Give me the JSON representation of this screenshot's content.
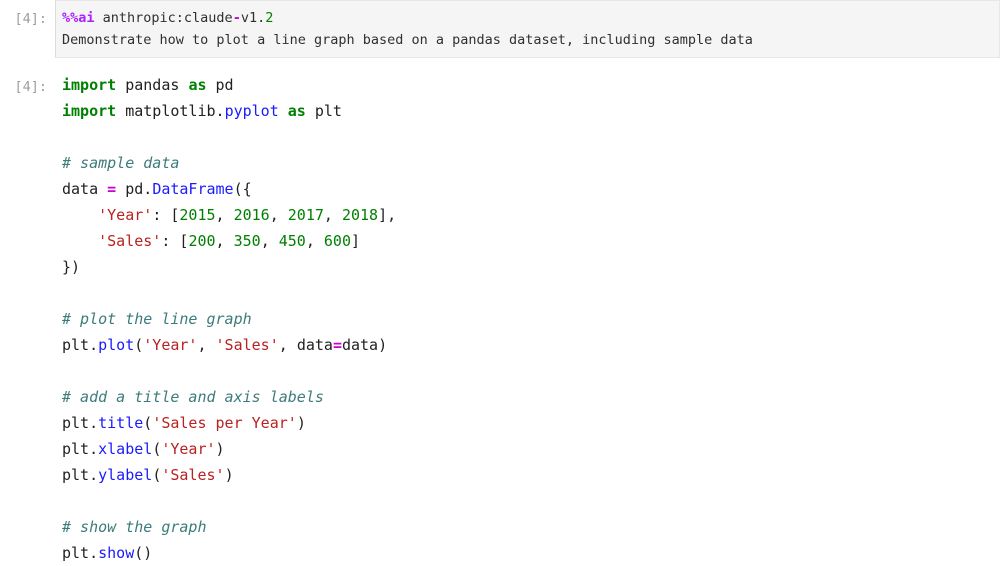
{
  "notebook": {
    "app": "jupyter-notebook",
    "background": "#ffffff",
    "colors": {
      "keyword": "#008000",
      "string": "#ba2121",
      "number": "#008000",
      "function": "#1a1aff",
      "operator": "#cc00cc",
      "comment": "#3d7b7b",
      "magic": "#aa22ff",
      "prompt": "#9e9e9e",
      "cell_background": "#f5f5f5",
      "cell_border": "#e7e7e7"
    },
    "cells": [
      {
        "id": "cell-magic",
        "type": "magic",
        "prompt_label": "[4]:",
        "execution_count": 4,
        "lines": {
          "l0_magic": "%%ai",
          "l0_provider": " anthropic:claude",
          "l0_dash": "-",
          "l0_version": "v1.",
          "l0_minor": "2",
          "l1_prompt": "Demonstrate how to plot a line graph based on a pandas dataset, including sample data"
        }
      },
      {
        "id": "cell-code",
        "type": "code",
        "prompt_label": "[4]:",
        "execution_count": 4,
        "lines": {
          "import_kw": "import",
          "pandas_mod": " pandas ",
          "as_kw1": "as",
          "pd_alias": " pd",
          "import_kw2": "import",
          "mpl_mod": " matplotlib.",
          "pyplot_mod": "pyplot",
          "as_kw2": " as",
          "plt_alias": " plt",
          "c_sample": "# sample data",
          "data_name": "data ",
          "eq1": "=",
          "pd_dot": " pd.",
          "dataframe_fn": "DataFrame",
          "open_paren_brace": "({",
          "year_key": "'Year'",
          "year_colon": ": [",
          "y2015": "2015",
          "y_sep1": ", ",
          "y2016": "2016",
          "y_sep2": ", ",
          "y2017": "2017",
          "y_sep3": ", ",
          "y2018": "2018",
          "year_end": "],",
          "sales_key": "'Sales'",
          "sales_colon": ": [",
          "s200": "200",
          "s_sep1": ", ",
          "s350": "350",
          "s_sep2": ", ",
          "s450": "450",
          "s_sep3": ", ",
          "s600": "600",
          "sales_end": "]",
          "close_brace_paren": "})",
          "c_plot": "# plot the line graph",
          "plt_dot1": "plt.",
          "plot_fn": "plot",
          "plot_open": "(",
          "plot_arg1": "'Year'",
          "plot_comma1": ", ",
          "plot_arg2": "'Sales'",
          "plot_comma2": ", ",
          "plot_kw": "data",
          "plot_eq": "=",
          "plot_kwval": "data",
          "plot_close": ")",
          "c_title": "# add a title and axis labels",
          "plt_dot2": "plt.",
          "title_fn": "title",
          "title_open": "(",
          "title_arg": "'Sales per Year'",
          "title_close": ")",
          "plt_dot3": "plt.",
          "xlabel_fn": "xlabel",
          "xlabel_open": "(",
          "xlabel_arg": "'Year'",
          "xlabel_close": ")",
          "plt_dot4": "plt.",
          "ylabel_fn": "ylabel",
          "ylabel_open": "(",
          "ylabel_arg": "'Sales'",
          "ylabel_close": ")",
          "c_show": "# show the graph",
          "plt_dot5": "plt.",
          "show_fn": "show",
          "show_parens": "()",
          "indent4": "    ",
          "indent8": "        "
        }
      }
    ]
  }
}
